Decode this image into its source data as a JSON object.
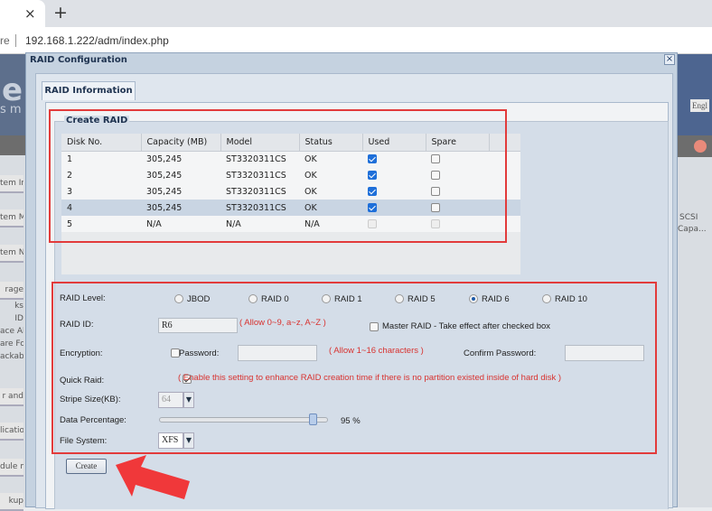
{
  "browser": {
    "close_tab": "×",
    "new_tab": "+",
    "address_prefix": "re",
    "address": "192.168.1.222/adm/index.php"
  },
  "background": {
    "sidebar": [
      "tem Ir",
      "tem M",
      "tem N",
      "rage",
      "ks",
      "ID",
      "ace Al",
      "are Fo",
      "ackabl",
      "r and",
      "licatio",
      "dule m",
      "kup"
    ],
    "lang": "Engl",
    "col1": "SCSI",
    "col2": "Capa...",
    "logo_big": "e",
    "logo_small": "s m"
  },
  "dialog": {
    "title": "RAID Configuration",
    "close": "×",
    "tab": "RAID Information"
  },
  "create_raid": {
    "legend": "Create RAID",
    "columns": [
      "Disk No.",
      "Capacity (MB)",
      "Model",
      "Status",
      "Used",
      "Spare"
    ],
    "rows": [
      {
        "disk": "1",
        "capacity": "305,245",
        "model": "ST3320311CS",
        "status": "OK",
        "used": true,
        "spare": false,
        "enabled": true
      },
      {
        "disk": "2",
        "capacity": "305,245",
        "model": "ST3320311CS",
        "status": "OK",
        "used": true,
        "spare": false,
        "enabled": true
      },
      {
        "disk": "3",
        "capacity": "305,245",
        "model": "ST3320311CS",
        "status": "OK",
        "used": true,
        "spare": false,
        "enabled": true
      },
      {
        "disk": "4",
        "capacity": "305,245",
        "model": "ST3320311CS",
        "status": "OK",
        "used": true,
        "spare": false,
        "enabled": true,
        "selected": true
      },
      {
        "disk": "5",
        "capacity": "N/A",
        "model": "N/A",
        "status": "N/A",
        "used": false,
        "spare": false,
        "enabled": false
      }
    ]
  },
  "form": {
    "raid_level_label": "RAID Level:",
    "raid_levels": [
      "JBOD",
      "RAID 0",
      "RAID 1",
      "RAID 5",
      "RAID 6",
      "RAID 10"
    ],
    "raid_level_selected": "RAID 6",
    "raid_id_label": "RAID ID:",
    "raid_id_value": "R6",
    "raid_id_note": "( Allow 0~9, a~z, A~Z )",
    "master_raid_label": "Master RAID - Take effect after checked box",
    "master_raid_checked": false,
    "encryption_label": "Encryption:",
    "encryption_checked": false,
    "password_label": "Password:",
    "password_value": "",
    "password_note": "( Allow 1~16 characters )",
    "confirm_password_label": "Confirm Password:",
    "confirm_password_value": "",
    "quick_raid_label": "Quick Raid:",
    "quick_raid_checked": true,
    "quick_raid_note": "( Enable this setting to enhance RAID creation time if there is no partition existed inside of hard disk )",
    "stripe_label": "Stripe Size(KB):",
    "stripe_value": "64",
    "data_pct_label": "Data Percentage:",
    "data_pct_value": 95,
    "data_pct_text": "95 %",
    "fs_label": "File System:",
    "fs_value": "XFS",
    "create_button": "Create"
  },
  "colors": {
    "highlight_box": "#e23b3b",
    "arrow": "#f0383a",
    "error_note": "#d8322f"
  }
}
